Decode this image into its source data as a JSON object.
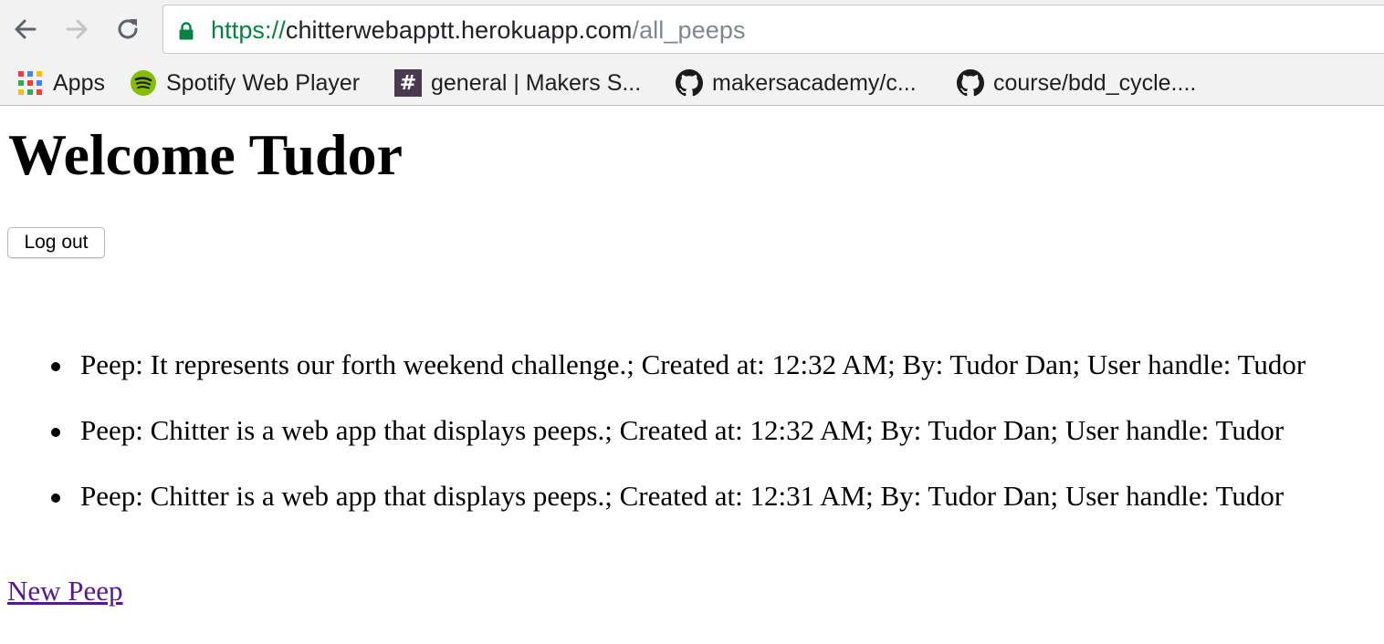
{
  "browser": {
    "url_scheme": "https://",
    "url_host": "chitterwebapptt.herokuapp.com",
    "url_path": "/all_peeps",
    "bookmarks": [
      {
        "label": "Apps",
        "icon": "apps-grid-icon"
      },
      {
        "label": "Spotify Web Player",
        "icon": "spotify-icon"
      },
      {
        "label": "general | Makers S...",
        "icon": "slack-hash-icon"
      },
      {
        "label": "makersacademy/c...",
        "icon": "github-icon"
      },
      {
        "label": "course/bdd_cycle....",
        "icon": "github-icon"
      }
    ],
    "colors": {
      "secure_green": "#0b8043",
      "spotify_green": "#84bd00",
      "slack_purple": "#4a3a4f"
    }
  },
  "page": {
    "heading": "Welcome Tudor",
    "logout_label": "Log out",
    "peeps": [
      {
        "text": "Peep: It represents our forth weekend challenge.; Created at: 12:32 AM; By: Tudor Dan; User handle: Tudor"
      },
      {
        "text": "Peep: Chitter is a web app that displays peeps.; Created at: 12:32 AM; By: Tudor Dan; User handle: Tudor"
      },
      {
        "text": "Peep: Chitter is a web app that displays peeps.; Created at: 12:31 AM; By: Tudor Dan; User handle: Tudor"
      }
    ],
    "new_peep_label": "New Peep",
    "colors": {
      "visited_link": "#551a8b"
    }
  }
}
